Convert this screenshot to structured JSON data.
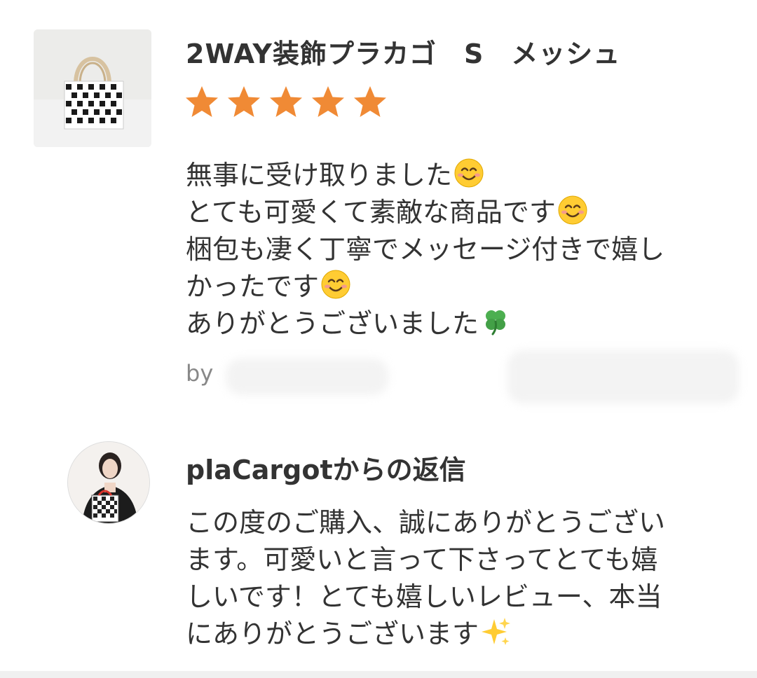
{
  "review": {
    "product_image": "product-thumbnail",
    "product_title": "2WAY装飾プラカゴ　S　メッシュ",
    "rating": 5,
    "rating_max": 5,
    "star_color": "#f08a35",
    "comment_lines": [
      "無事に受け取りました",
      "とても可愛くて素敵な商品です",
      "梱包も凄く丁寧でメッセージ付きで嬉し",
      "かったです",
      "ありがとうございました"
    ],
    "comment_emojis": [
      "smiling-face-emoji",
      "smiling-face-emoji",
      "",
      "smiling-face-emoji",
      "four-leaf-clover-emoji"
    ],
    "by_prefix": "by"
  },
  "reply": {
    "avatar": "seller-avatar",
    "title": "plaCargotからの返信",
    "body_lines": [
      "この度のご購入、誠にありがとうござい",
      "ます。可愛いと言って下さってとても嬉",
      "しいです！とても嬉しいレビュー、本当",
      "にありがとうございます"
    ],
    "body_end_emoji": "sparkles-emoji"
  }
}
